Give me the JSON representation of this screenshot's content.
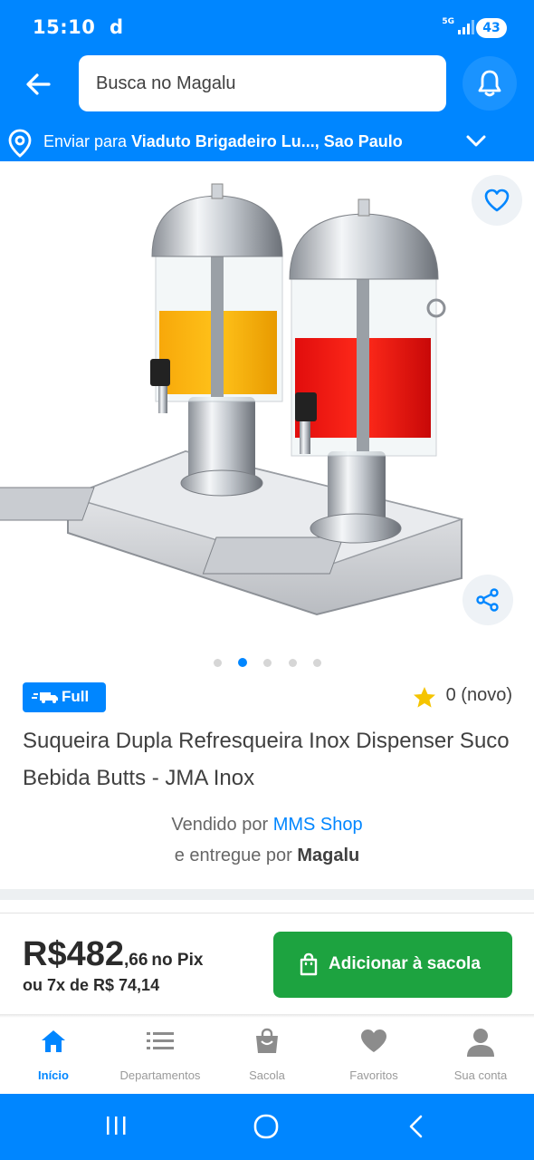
{
  "status_bar": {
    "time": "15:10",
    "carrier_icon": "d",
    "network": "5G",
    "battery": "43"
  },
  "header": {
    "back_icon": "arrow-left-icon",
    "search_placeholder": "Busca no Magalu",
    "bell_icon": "bell-icon"
  },
  "shipping": {
    "prefix": "Enviar para ",
    "address": "Viaduto Brigadeiro Lu..., Sao Paulo",
    "chevron_icon": "chevron-down-icon"
  },
  "product": {
    "image_alt": "Suqueira dupla inox",
    "carousel": {
      "count": 5,
      "active_index": 1
    },
    "badge": "Full",
    "rating_value": "0",
    "rating_label": "(novo)",
    "title": "Suqueira Dupla Refresqueira Inox Dispenser Suco Bebida Butts - JMA Inox",
    "sold_by_prefix": "Vendido por ",
    "seller": "MMS Shop",
    "delivered_by_prefix": "e entregue por ",
    "delivered_by": "Magalu"
  },
  "purchase": {
    "currency": "R$",
    "price_integer": "482",
    "price_cents": ",66",
    "price_suffix": "no Pix",
    "installments": "ou 7x de R$ 74,14",
    "add_button": "Adicionar à sacola"
  },
  "bottom_nav": [
    {
      "label": "Início",
      "icon": "home-icon",
      "active": true
    },
    {
      "label": "Departamentos",
      "icon": "menu-icon",
      "active": false
    },
    {
      "label": "Sacola",
      "icon": "bag-icon",
      "active": false
    },
    {
      "label": "Favoritos",
      "icon": "heart-icon",
      "active": false
    },
    {
      "label": "Sua conta",
      "icon": "user-icon",
      "active": false
    }
  ],
  "colors": {
    "brand_blue": "#0086ff",
    "buy_green": "#1da340",
    "star_yellow": "#f5c400"
  }
}
